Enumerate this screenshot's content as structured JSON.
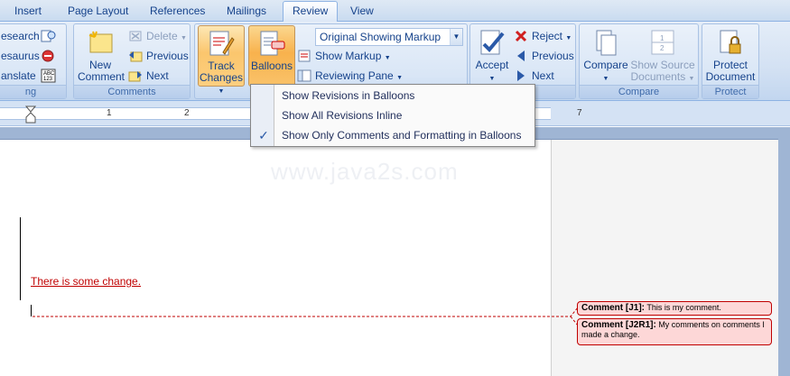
{
  "tabs": [
    "Insert",
    "Page Layout",
    "References",
    "Mailings",
    "Review",
    "View"
  ],
  "proofing": {
    "items": [
      "esearch",
      "esaurus",
      "anslate"
    ],
    "group_label": "ng"
  },
  "comments": {
    "new_comment": "New Comment",
    "delete": "Delete",
    "previous": "Previous",
    "next": "Next",
    "group_label": "Comments"
  },
  "tracking": {
    "track_changes": "Track Changes",
    "balloons": "Balloons",
    "display_for_review": "Original Showing Markup",
    "show_markup": "Show Markup",
    "reviewing_pane": "Reviewing Pane"
  },
  "changes": {
    "accept": "Accept",
    "reject": "Reject",
    "previous": "Previous",
    "next": "Next",
    "group_label": "es"
  },
  "compare": {
    "compare": "Compare",
    "show_source": "Show Source Documents",
    "group_label": "Compare"
  },
  "protect": {
    "protect_document": "Protect Document",
    "group_label": "Protect"
  },
  "balloons_menu": {
    "items": [
      {
        "label": "Show Revisions in Balloons",
        "checked": false
      },
      {
        "label": "Show All Revisions Inline",
        "checked": false
      },
      {
        "label": "Show Only Comments and Formatting in Balloons",
        "checked": true
      }
    ]
  },
  "ruler": {
    "numbers": [
      "1",
      "2",
      "7"
    ]
  },
  "document": {
    "watermark": "www.java2s.com",
    "changed_text": "There is some change."
  },
  "balloons": [
    {
      "ref": "Comment [J1]:",
      "text": "This is my comment."
    },
    {
      "ref": "Comment [J2R1]:",
      "text": "My comments on comments I made a change."
    }
  ],
  "colors": {
    "ribbon": "#d3e1f3",
    "pressed": "#f8b24d",
    "revision": "#c00000",
    "balloon_fill": "#fdd7d7"
  }
}
